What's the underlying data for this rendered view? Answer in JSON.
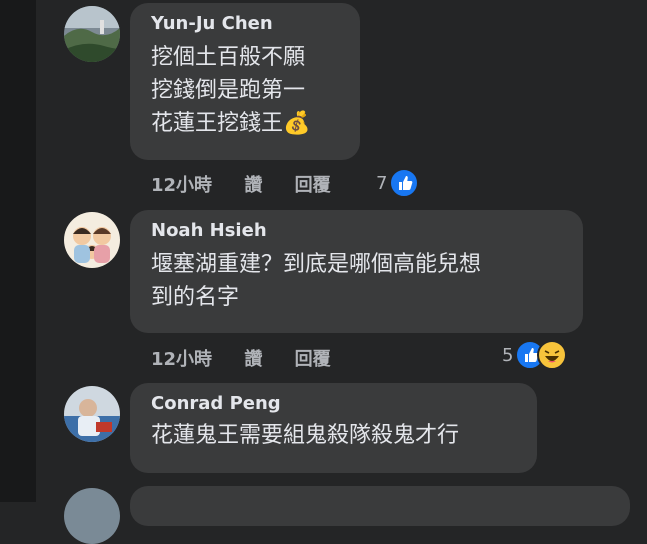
{
  "comments": [
    {
      "author": "Yun-Ju Chen",
      "text": "挖個土百般不願\n挖錢倒是跑第一\n花蓮王挖錢王💰",
      "time": "12小時",
      "like_label": "讚",
      "reply_label": "回覆",
      "reaction_count": "7",
      "reactions": [
        "like"
      ]
    },
    {
      "author": "Noah Hsieh",
      "text": "堰塞湖重建？到底是哪個高能兒想\n到的名字",
      "time": "12小時",
      "like_label": "讚",
      "reply_label": "回覆",
      "reaction_count": "5",
      "reactions": [
        "like",
        "haha"
      ]
    },
    {
      "author": "Conrad Peng",
      "text": "花蓮鬼王需要組鬼殺隊殺鬼才行",
      "reactions": []
    }
  ]
}
